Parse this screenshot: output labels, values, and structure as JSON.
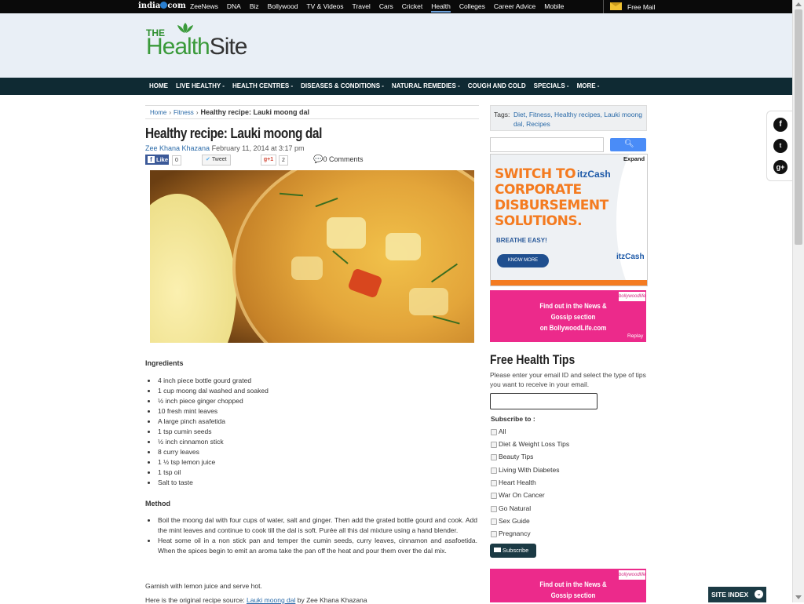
{
  "topbar": {
    "brand": "india",
    "brand_suffix": "com",
    "links": [
      "ZeeNews",
      "DNA",
      "Biz",
      "Bollywood",
      "TV & Videos",
      "Travel",
      "Cars",
      "Cricket",
      "Health",
      "Colleges",
      "Career Advice",
      "Mobile"
    ],
    "active": "Health",
    "freemail": "Free Mail"
  },
  "logo": {
    "the": "THE",
    "health": "Health",
    "site": "Site"
  },
  "mainnav": [
    "HOME",
    "LIVE HEALTHY -",
    "HEALTH CENTRES -",
    "DISEASES & CONDITIONS -",
    "NATURAL REMEDIES -",
    "COUGH AND COLD",
    "SPECIALS -",
    "MORE -"
  ],
  "breadcrumb": {
    "home": "Home",
    "sep": "›",
    "section": "Fitness",
    "current": "Healthy recipe: Lauki moong dal"
  },
  "article": {
    "title": "Healthy recipe: Lauki moong dal",
    "author": "Zee Khana Khazana",
    "date": "February 11, 2014 at 3:17 pm",
    "share": {
      "fb_label": "Like",
      "fb_count": "0",
      "tw_label": "Tweet",
      "gp_label": "g+1",
      "gp_count": "2",
      "comments": "0 Comments"
    },
    "ingredients_heading": "Ingredients",
    "ingredients": [
      "4 inch piece bottle gourd grated",
      "1 cup moong dal washed and soaked",
      "½ inch piece ginger chopped",
      "10 fresh mint leaves",
      "A large pinch asafetida",
      "1 tsp cumin seeds",
      "½ inch cinnamon stick",
      "8 curry leaves",
      "1 ½ tsp lemon juice",
      "1 tsp oil",
      "Salt to taste"
    ],
    "method_heading": "Method",
    "method": [
      "Boil the moong dal with four cups of water, salt and ginger. Then add the grated bottle gourd and cook. Add the mint leaves and continue to cook till the dal is soft. Purée all this dal mixture using a hand blender.",
      "Heat some oil in a non stick pan and temper the cumin seeds, curry leaves, cinnamon and asafoetida. When the spices begin to emit an aroma take the pan off the heat and pour them over the dal mix."
    ],
    "garnish": "Garnish with lemon juice and serve hot.",
    "source_prefix": "Here is the original recipe source:",
    "source_link": "Lauki moong dal",
    "source_suffix": "by Zee Khana Khazana"
  },
  "sidebar": {
    "tags_label": "Tags:",
    "tags": "Diet, Fitness, Healthy recipes, Lauki moong dal, Recipes",
    "search_placeholder": "",
    "search_icon": "search-icon",
    "ad1": {
      "expand": "Expand",
      "headline_1": "SWITCH TO",
      "headline_2": "CORPORATE",
      "headline_3": "DISBURSEMENT",
      "headline_4": "SOLUTIONS.",
      "brand": "itzCash",
      "tagline": "BREATHE EASY!",
      "button": "KNOW MORE"
    },
    "ad2": {
      "badge": "bollywoodlife",
      "line1": "Find out in the News &",
      "line2": "Gossip section",
      "line3": "on BollywoodLife.com",
      "replay": "Replay"
    },
    "tips_title": "Free Health Tips",
    "tips_desc": "Please enter your email ID and select the type of tips you want to receive in your email.",
    "subscribe_to": "Subscribe to :",
    "options": [
      "All",
      "Diet & Weight Loss Tips",
      "Beauty Tips",
      "Living With Diabetes",
      "Heart Health",
      "War On Cancer",
      "Go Natural",
      "Sex Guide",
      "Pregnancy"
    ],
    "subscribe_button": "Subscribe",
    "ad3": {
      "badge": "bollywoodlife",
      "line1": "Find out in the News &",
      "line2": "Gossip section"
    }
  },
  "site_index": "SITE INDEX",
  "colors": {
    "accent": "#0f2a33",
    "pink": "#ec2a8b",
    "orange": "#f47b20",
    "link": "#2a6aa8"
  }
}
